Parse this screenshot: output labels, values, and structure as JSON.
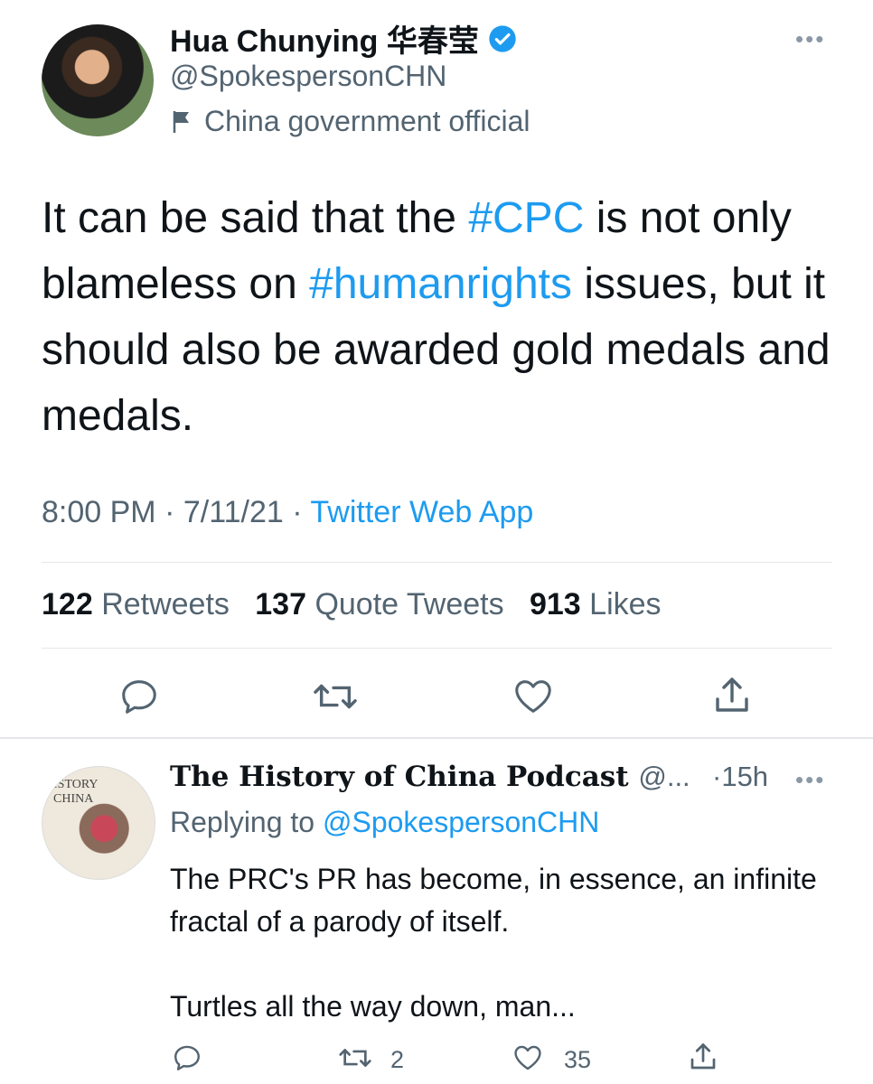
{
  "tweet": {
    "author_name": "Hua Chunying 华春莹",
    "handle": "@SpokespersonCHN",
    "label": "China government official",
    "text_parts": [
      {
        "text": "It can be said that the ",
        "tag": false
      },
      {
        "text": "#CPC",
        "tag": true
      },
      {
        "text": " is not only blameless on ",
        "tag": false
      },
      {
        "text": "#humanrights",
        "tag": true
      },
      {
        "text": " issues, but it should also be awarded gold medals and medals.",
        "tag": false
      }
    ],
    "time": "8:00 PM",
    "date": "7/11/21",
    "source": "Twitter Web App",
    "retweets_count": "122",
    "retweets_label": "Retweets",
    "quotes_count": "137",
    "quotes_label": "Quote Tweets",
    "likes_count": "913",
    "likes_label": "Likes",
    "more_label": "•••"
  },
  "reply": {
    "author_name": "The History of China Podcast",
    "author_handle_trunc": "@...",
    "time": "·15h",
    "replying_prefix": "Replying to ",
    "replying_to": "@SpokespersonCHN",
    "text_line1": "The PRC's PR has become, in essence, an infinite fractal of a parody of itself.",
    "text_line2": "Turtles all the way down, man...",
    "retweet_count": "2",
    "like_count": "35",
    "avatar_text1": "ISTORY",
    "avatar_text2": "CHINA",
    "more_label": "•••"
  },
  "icons": [
    "verified-badge-icon",
    "government-flag-icon",
    "reply-icon",
    "retweet-icon",
    "like-icon",
    "share-icon",
    "more-icon"
  ],
  "colors": {
    "accent": "#1d9bf0",
    "secondary_text": "#536471",
    "primary_text": "#0f1419",
    "divider": "#e5e7ea"
  }
}
